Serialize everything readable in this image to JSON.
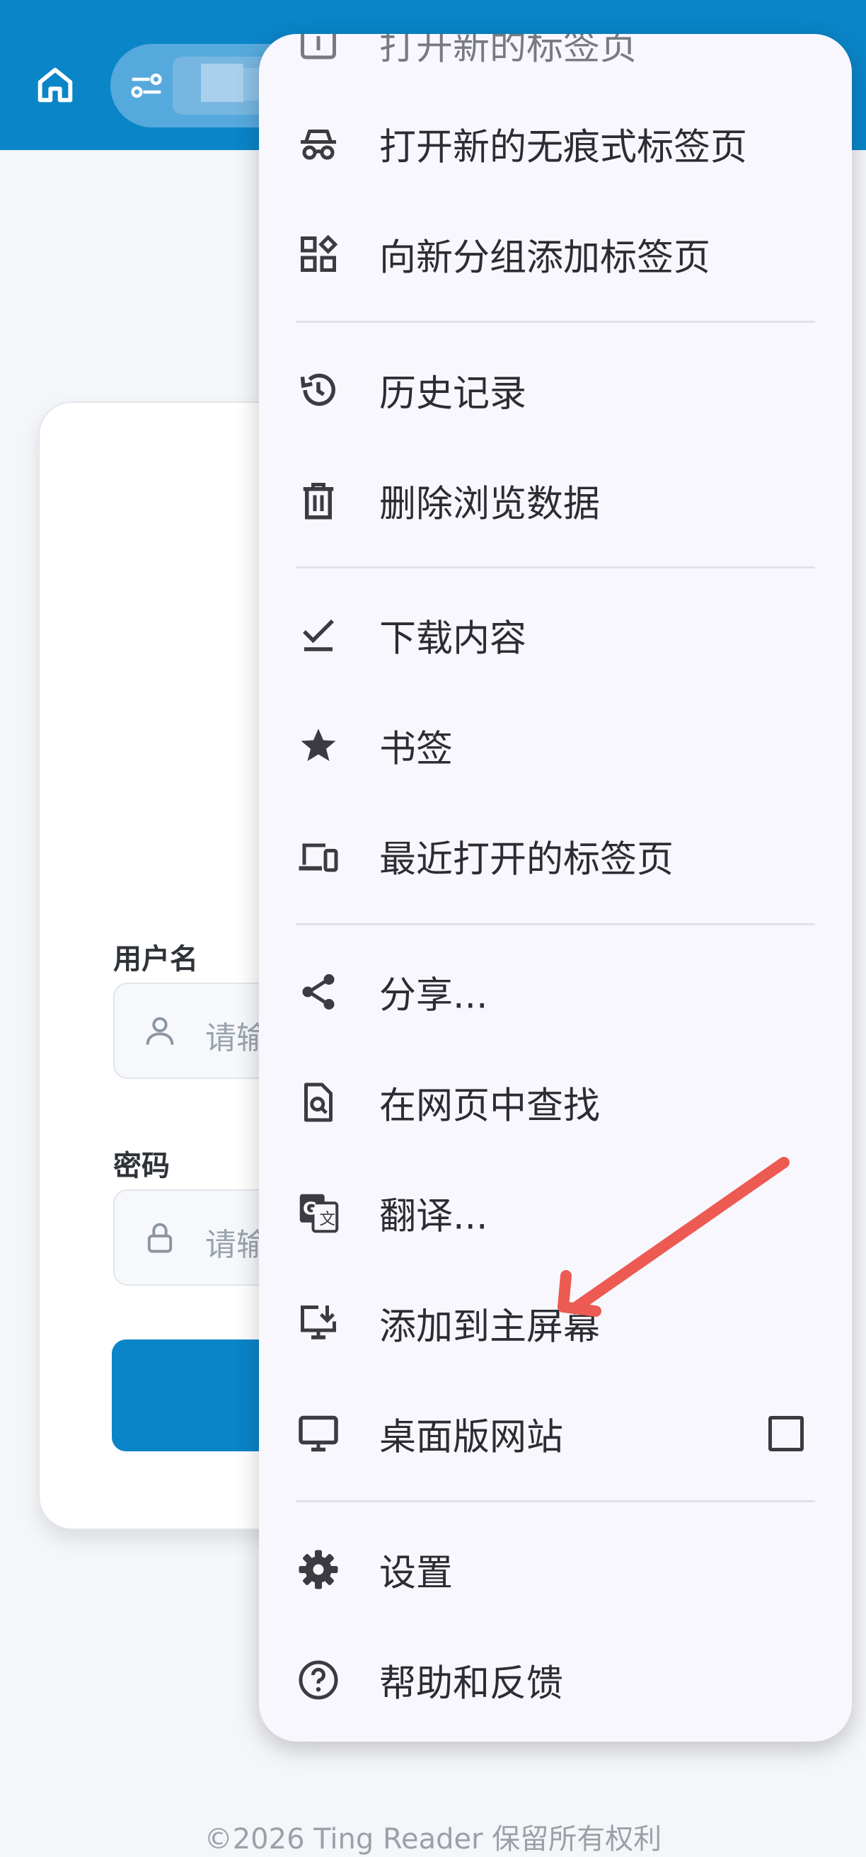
{
  "login": {
    "username_label": "用户名",
    "username_placeholder": "请输",
    "password_label": "密码",
    "password_placeholder": "请输"
  },
  "footer": {
    "copyright": "©2026 Ting Reader 保留所有权利"
  },
  "menu": {
    "items": [
      {
        "label": "打开新的标签页",
        "icon": "new-tab-icon"
      },
      {
        "label": "打开新的无痕式标签页",
        "icon": "incognito-icon"
      },
      {
        "label": "向新分组添加标签页",
        "icon": "tab-group-icon"
      },
      {
        "label": "历史记录",
        "icon": "history-icon"
      },
      {
        "label": "删除浏览数据",
        "icon": "trash-icon"
      },
      {
        "label": "下载内容",
        "icon": "download-check-icon"
      },
      {
        "label": "书签",
        "icon": "star-icon"
      },
      {
        "label": "最近打开的标签页",
        "icon": "devices-icon"
      },
      {
        "label": "分享...",
        "icon": "share-icon"
      },
      {
        "label": "在网页中查找",
        "icon": "find-in-page-icon"
      },
      {
        "label": "翻译...",
        "icon": "translate-icon"
      },
      {
        "label": "添加到主屏幕",
        "icon": "add-to-home-icon"
      },
      {
        "label": "桌面版网站",
        "icon": "monitor-icon",
        "checkbox": false
      },
      {
        "label": "设置",
        "icon": "gear-icon"
      },
      {
        "label": "帮助和反馈",
        "icon": "help-icon"
      }
    ]
  },
  "colors": {
    "accent": "#0a85c8",
    "menu_bg": "#f9f7fe",
    "annotation_arrow": "#ec5a52"
  }
}
